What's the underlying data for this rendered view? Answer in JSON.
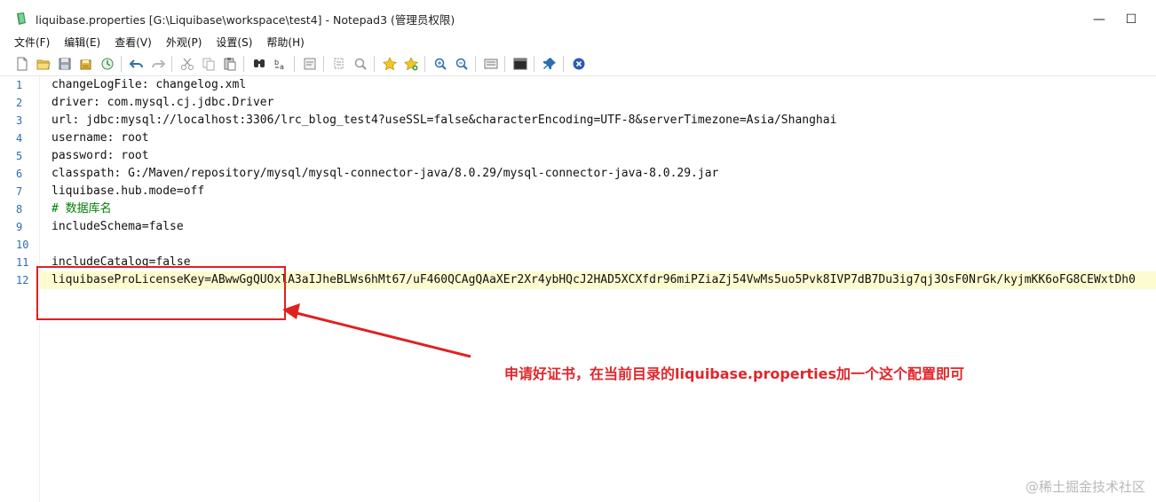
{
  "window": {
    "title": "liquibase.properties [G:\\Liquibase\\workspace\\test4] - Notepad3  (管理员权限)",
    "minimize_glyph": "—",
    "maximize_glyph": "☐"
  },
  "menu": [
    "文件(F)",
    "编辑(E)",
    "查看(V)",
    "外观(P)",
    "设置(S)",
    "帮助(H)"
  ],
  "toolbar_icons": [
    "new-file-icon",
    "open-folder-icon",
    "save-icon",
    "save-as-icon",
    "history-icon",
    "undo-icon",
    "redo-icon",
    "cut-icon",
    "copy-icon",
    "paste-icon",
    "find-icon",
    "replace-icon",
    "wrap-icon",
    "copy-all-icon",
    "zoom-search-icon",
    "favorite-icon",
    "add-favorite-icon",
    "zoom-in-icon",
    "zoom-out-icon",
    "settings-icon",
    "terminal-icon",
    "pin-icon",
    "close-file-icon"
  ],
  "editor": {
    "lines": [
      {
        "n": "1",
        "text": "changeLogFile: changelog.xml",
        "type": "normal"
      },
      {
        "n": "2",
        "text": "driver: com.mysql.cj.jdbc.Driver",
        "type": "normal"
      },
      {
        "n": "3",
        "text": "url: jdbc:mysql://localhost:3306/lrc_blog_test4?useSSL=false&characterEncoding=UTF-8&serverTimezone=Asia/Shanghai",
        "type": "normal"
      },
      {
        "n": "4",
        "text": "username: root",
        "type": "normal"
      },
      {
        "n": "5",
        "text": "password: root",
        "type": "normal"
      },
      {
        "n": "6",
        "text": "classpath: G:/Maven/repository/mysql/mysql-connector-java/8.0.29/mysql-connector-java-8.0.29.jar",
        "type": "normal"
      },
      {
        "n": "7",
        "text": "liquibase.hub.mode=off",
        "type": "normal"
      },
      {
        "n": "8",
        "text": "# 数据库名",
        "type": "comment"
      },
      {
        "n": "9",
        "text": "includeSchema=false",
        "type": "normal"
      },
      {
        "n": "10",
        "text": "",
        "type": "normal"
      },
      {
        "n": "11",
        "text": "includeCatalog=false",
        "type": "normal"
      },
      {
        "n": "12",
        "text": "liquibaseProLicenseKey=ABwwGgQUOxlA3aIJheBLWs6hMt67/uF460QCAgQAaXEr2Xr4ybHQcJ2HAD5XCXfdr96miPZiaZj54VwMs5uo5Pvk8IVP7dB7Du3ig7qj3OsF0NrGk/kyjmKK6oFG8CEWxtDh0",
        "type": "normal"
      }
    ],
    "current_line": 12
  },
  "annotation": {
    "text": "申请好证书，在当前目录的liquibase.properties加一个这个配置即可",
    "color": "#e0262b"
  },
  "watermark": "@稀土掘金技术社区"
}
